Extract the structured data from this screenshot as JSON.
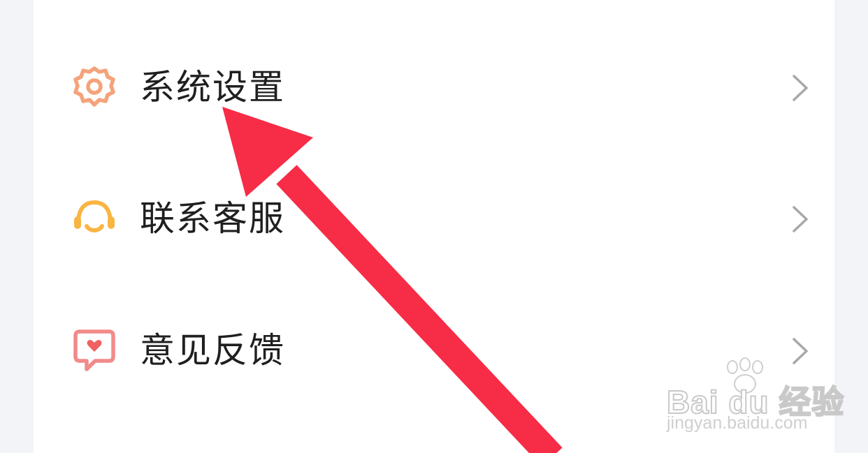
{
  "menu": {
    "items": [
      {
        "label": "系统设置",
        "icon": "gear-icon",
        "icon_color": "#f4a37a"
      },
      {
        "label": "联系客服",
        "icon": "headset-icon",
        "icon_color": "#f9b542"
      },
      {
        "label": "意见反馈",
        "icon": "feedback-heart-icon",
        "icon_color": "#f28a8a"
      }
    ]
  },
  "annotation": {
    "arrow_color": "#f72c46"
  },
  "watermark": {
    "brand": "Bai du 经验",
    "url": "jingyan.baidu.com"
  }
}
